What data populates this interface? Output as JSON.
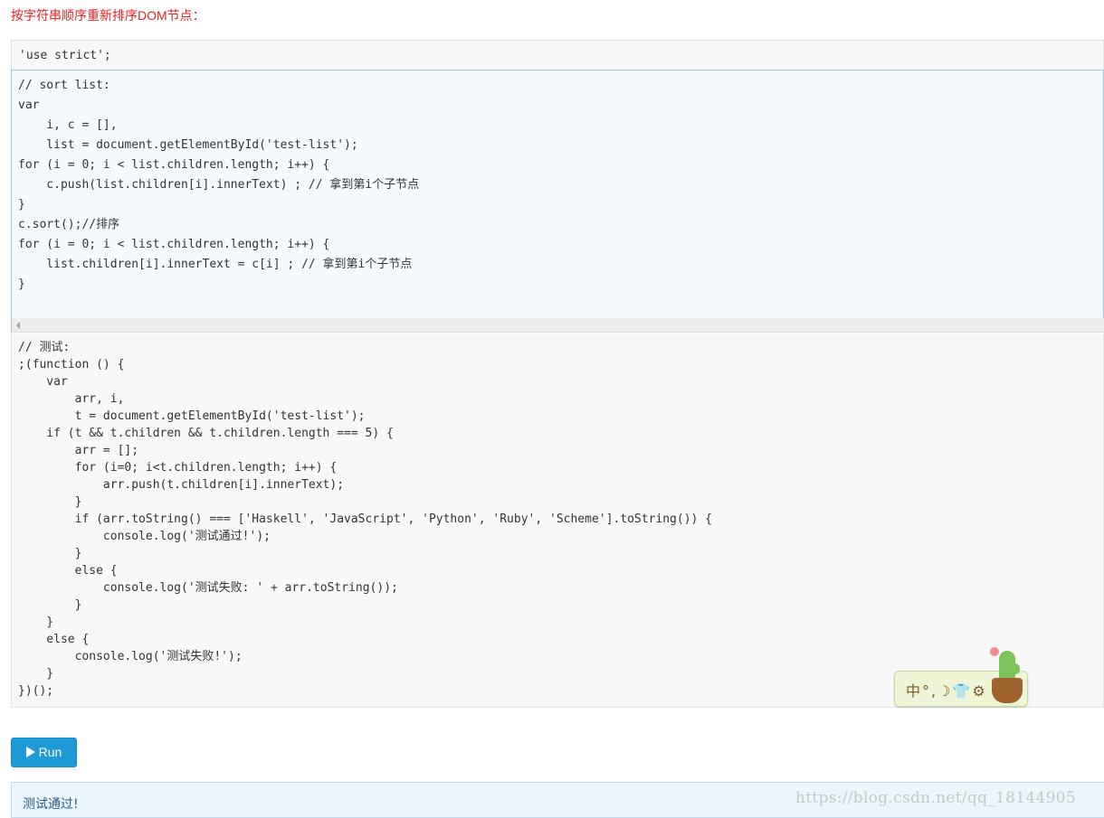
{
  "heading": "按字符串顺序重新排序DOM节点：",
  "code": {
    "strict_line": "'use strict';",
    "editable": "// sort list:\nvar\n    i, c = [],\n    list = document.getElementById('test-list');\nfor (i = 0; i < list.children.length; i++) {\n    c.push(list.children[i].innerText) ; // 拿到第i个子节点\n}\nc.sort();//排序\nfor (i = 0; i < list.children.length; i++) {\n    list.children[i].innerText = c[i] ; // 拿到第i个子节点\n}",
    "test": "// 测试:\n;(function () {\n    var\n        arr, i,\n        t = document.getElementById('test-list');\n    if (t && t.children && t.children.length === 5) {\n        arr = [];\n        for (i=0; i<t.children.length; i++) {\n            arr.push(t.children[i].innerText);\n        }\n        if (arr.toString() === ['Haskell', 'JavaScript', 'Python', 'Ruby', 'Scheme'].toString()) {\n            console.log('测试通过!');\n        }\n        else {\n            console.log('测试失败: ' + arr.toString());\n        }\n    }\n    else {\n        console.log('测试失败!');\n    }\n})();"
  },
  "run_button": {
    "label": "Run",
    "icon": "play-icon"
  },
  "output": {
    "text": "测试通过!"
  },
  "watermark": "https://blog.csdn.net/qq_18144905",
  "ime_toolbar": {
    "text": "中°,☽👕⚙"
  },
  "colors": {
    "heading": "#e22222",
    "run_button": "#1e9bd7",
    "output_bg": "#eaf5fc",
    "editor_bg": "#f5faff"
  }
}
